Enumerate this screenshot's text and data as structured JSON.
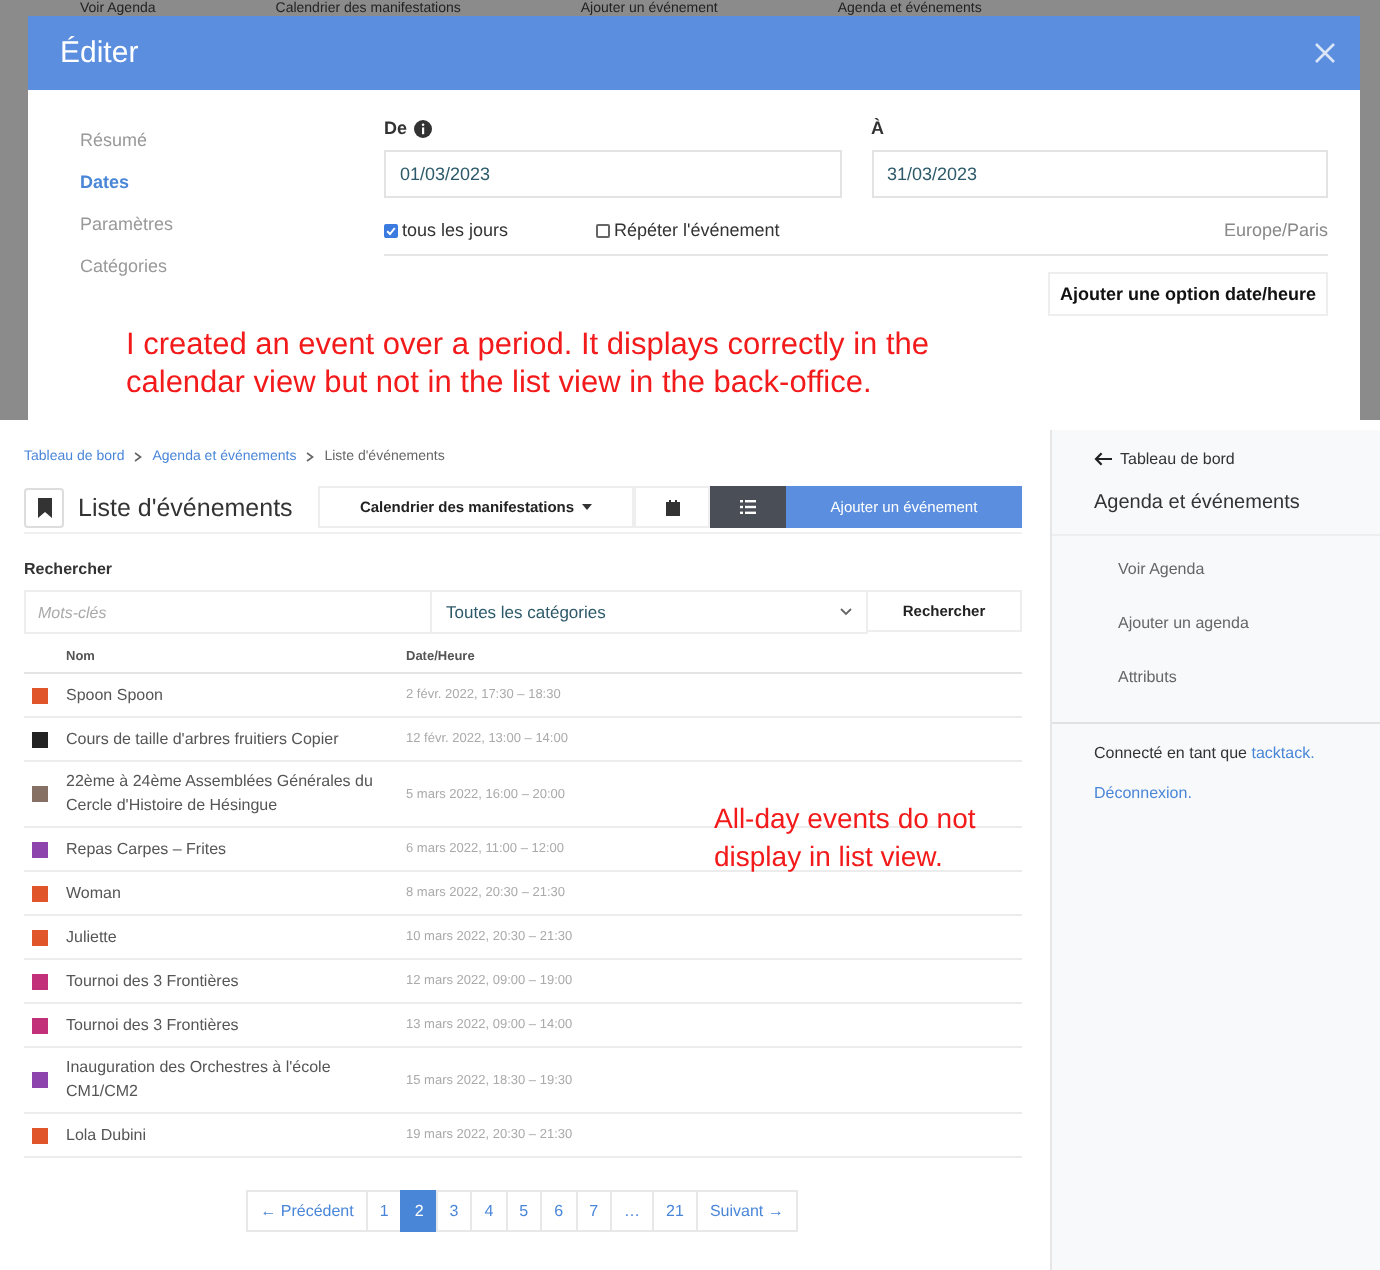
{
  "background_bar": {
    "title": "Voir Agenda",
    "dropdown": "Calendrier des manifestations",
    "button": "Ajouter un événement",
    "sidebar_title": "Agenda et événements"
  },
  "modal": {
    "title": "Éditer",
    "nav": [
      {
        "label": "Résumé",
        "selected": false
      },
      {
        "label": "Dates",
        "selected": true
      },
      {
        "label": "Paramètres",
        "selected": false
      },
      {
        "label": "Catégories",
        "selected": false
      }
    ],
    "from": {
      "label": "De",
      "value": "01/03/2023"
    },
    "to": {
      "label": "À",
      "value": "31/03/2023"
    },
    "all_day": {
      "label": "tous les jours",
      "checked": true
    },
    "repeat": {
      "label": "Répéter l'événement",
      "checked": false
    },
    "timezone": "Europe/Paris",
    "add_button": "Ajouter une option date/heure",
    "annotation": "I created an event over a period. It displays correctly in the calendar view but not in the list view in the back-office."
  },
  "list": {
    "breadcrumb": [
      "Tableau de bord",
      "Agenda et événements",
      "Liste d'événements"
    ],
    "title": "Liste d'événements",
    "calendar_dropdown": "Calendrier des manifestations",
    "views": [
      {
        "kind": "calendar",
        "selected": false
      },
      {
        "kind": "list",
        "selected": true
      }
    ],
    "add_button": "Ajouter un événement",
    "search_label": "Rechercher",
    "keywords": {
      "placeholder": "Mots-clés"
    },
    "category": "Toutes les catégories",
    "search_button": "Rechercher",
    "columns": [
      "Nom",
      "Date/Heure"
    ],
    "rows": [
      {
        "name": "Spoon Spoon",
        "date": "2 févr. 2022, 17:30 – 18:30",
        "color": "#e0562a"
      },
      {
        "name": "Cours de taille d'arbres fruitiers Copier",
        "date": "12 févr. 2022, 13:00 – 14:00",
        "color": "#222222"
      },
      {
        "name": "22ème à 24ème Assemblées Générales du Cercle d'Histoire de Hésingue",
        "date": "5 mars 2022, 16:00 – 20:00",
        "color": "#857063"
      },
      {
        "name": "Repas Carpes – Frites",
        "date": "6 mars 2022, 11:00 – 12:00",
        "color": "#8e44ad"
      },
      {
        "name": "Woman",
        "date": "8 mars 2022, 20:30 – 21:30",
        "color": "#e0562a"
      },
      {
        "name": "Juliette",
        "date": "10 mars 2022, 20:30 – 21:30",
        "color": "#e0562a"
      },
      {
        "name": "Tournoi des 3 Frontières",
        "date": "12 mars 2022, 09:00 – 19:00",
        "color": "#c2307a"
      },
      {
        "name": "Tournoi des 3 Frontières",
        "date": "13 mars 2022, 09:00 – 14:00",
        "color": "#c2307a"
      },
      {
        "name": "Inauguration des Orchestres à l'école CM1/CM2",
        "date": "15 mars 2022, 18:30 – 19:30",
        "color": "#8e44ad"
      },
      {
        "name": "Lola Dubini",
        "date": "19 mars 2022, 20:30 – 21:30",
        "color": "#e0562a"
      }
    ],
    "annotation": "All-day events do not display in list view.",
    "pagination": {
      "previous": "← Précédent",
      "pages": [
        {
          "label": "1",
          "selected": false
        },
        {
          "label": "2",
          "selected": true
        },
        {
          "label": "3",
          "selected": false
        },
        {
          "label": "4",
          "selected": false
        },
        {
          "label": "5",
          "selected": false
        },
        {
          "label": "6",
          "selected": false
        },
        {
          "label": "7",
          "selected": false
        },
        {
          "label": "…",
          "selected": false
        },
        {
          "label": "21",
          "selected": false
        }
      ],
      "next": "Suivant →"
    }
  },
  "sidebar": {
    "back": "Tableau de bord",
    "title": "Agenda et événements",
    "items": [
      "Voir Agenda",
      "Ajouter un agenda",
      "Attributs"
    ],
    "connected": "Connecté en tant que",
    "user": "tacktack.",
    "logout": "Déconnexion."
  }
}
